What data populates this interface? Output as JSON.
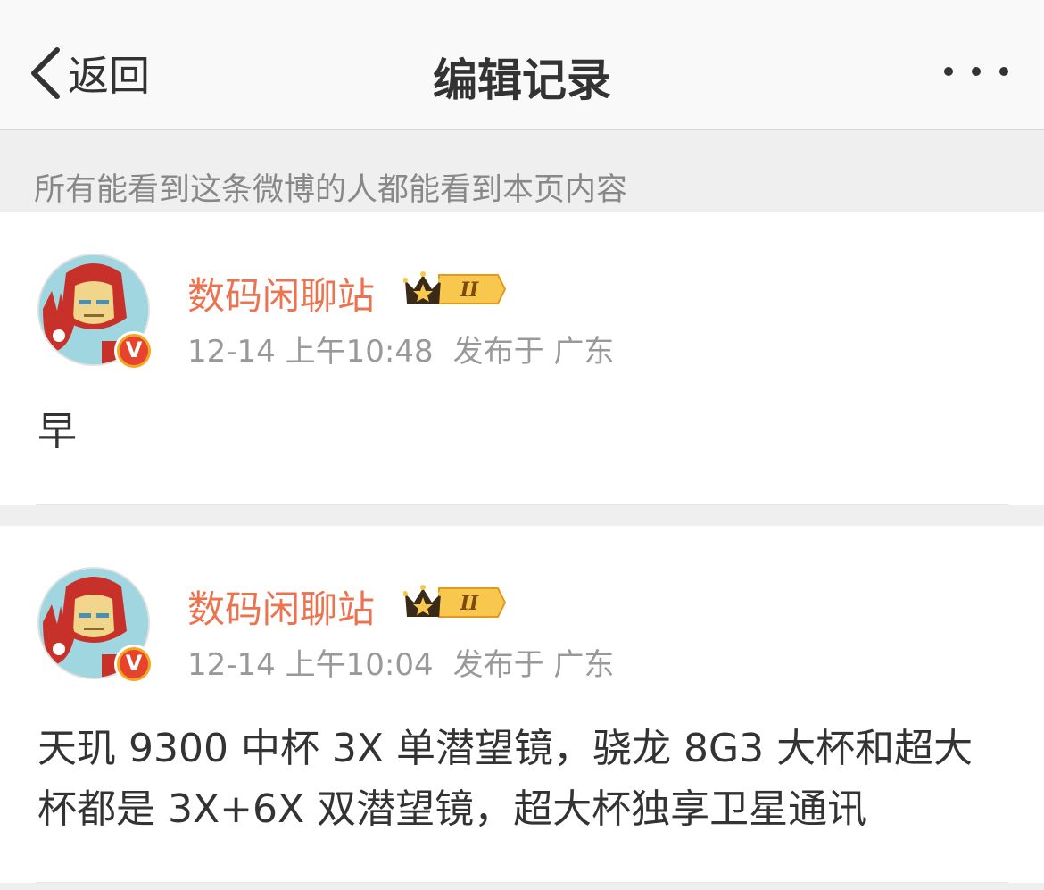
{
  "navbar": {
    "back_label": "返回",
    "title": "编辑记录"
  },
  "notice": "所有能看到这条微博的人都能看到本页内容",
  "records": [
    {
      "username": "数码闲聊站",
      "vip_level": "II",
      "verified_mark": "V",
      "time": "12-14 上午10:48",
      "location": "发布于 广东",
      "content": "早"
    },
    {
      "username": "数码闲聊站",
      "vip_level": "II",
      "verified_mark": "V",
      "time": "12-14 上午10:04",
      "location": "发布于 广东",
      "content": "天玑 9300 中杯 3X 单潜望镜，骁龙 8G3 大杯和超大杯都是 3X+6X 双潜望镜，超大杯独享卫星通讯"
    }
  ],
  "colors": {
    "username": "#eb7350",
    "meta": "#999999",
    "page_background": "#efefef",
    "verified_badge": "#e6442d"
  },
  "icons": {
    "back": "chevron-left-icon",
    "more": "ellipsis-icon",
    "vip": "crown-vip-icon",
    "verified": "verified-v-icon"
  }
}
